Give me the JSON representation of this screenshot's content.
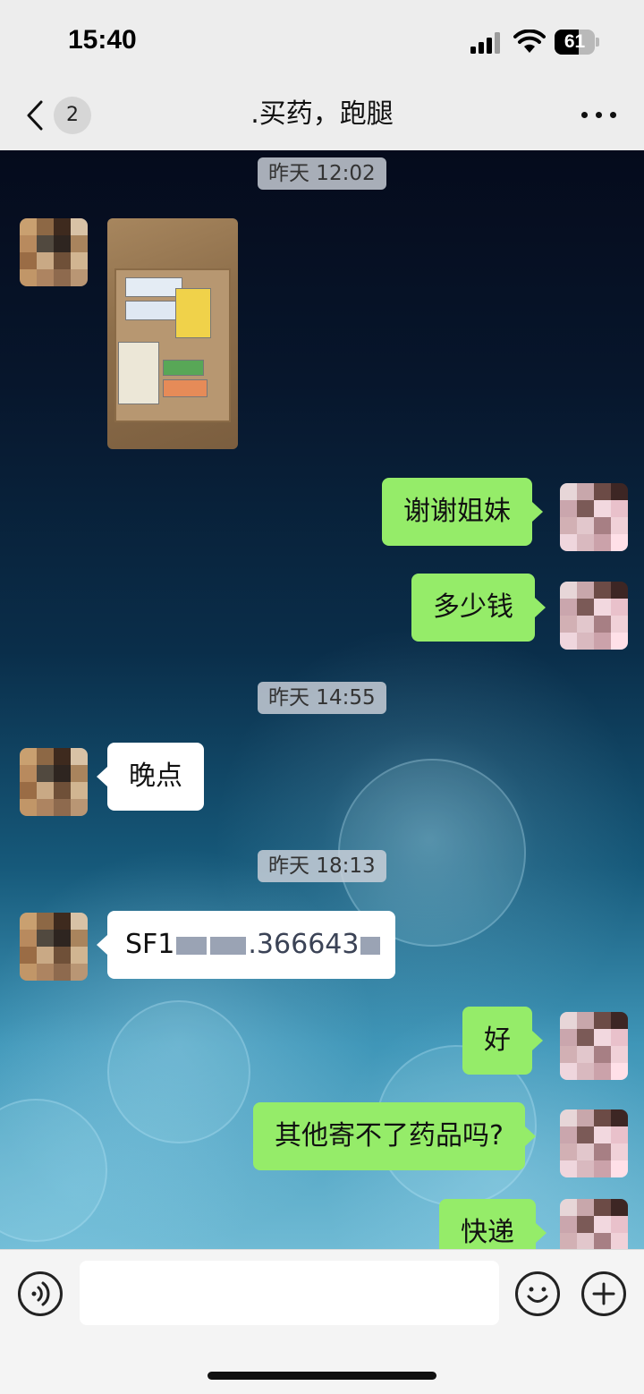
{
  "status_bar": {
    "time": "15:40",
    "battery_level": "61",
    "battery_fraction": 0.61,
    "icons": [
      "signal-icon",
      "wifi-icon",
      "battery-icon"
    ]
  },
  "nav": {
    "back_icon": "chevron-left-icon",
    "unread_count": "2",
    "title": ".买药，跑腿",
    "more_icon": "more-horizontal-icon"
  },
  "messages": {
    "ts1": "昨天 12:02",
    "m1_photo": "photo of boxed medicine",
    "m2": "谢谢姐妹",
    "m3": "多少钱",
    "ts2": "昨天 14:55",
    "m4": "晚点",
    "ts3": "昨天 18:13",
    "m5_prefix": "SF1",
    "m5_middle": ".366643",
    "m6": "好",
    "m7": "其他寄不了药品吗?",
    "m8": "快递"
  },
  "input_bar": {
    "voice_icon": "voice-icon",
    "emoji_icon": "emoji-icon",
    "plus_icon": "plus-icon",
    "input_value": ""
  }
}
